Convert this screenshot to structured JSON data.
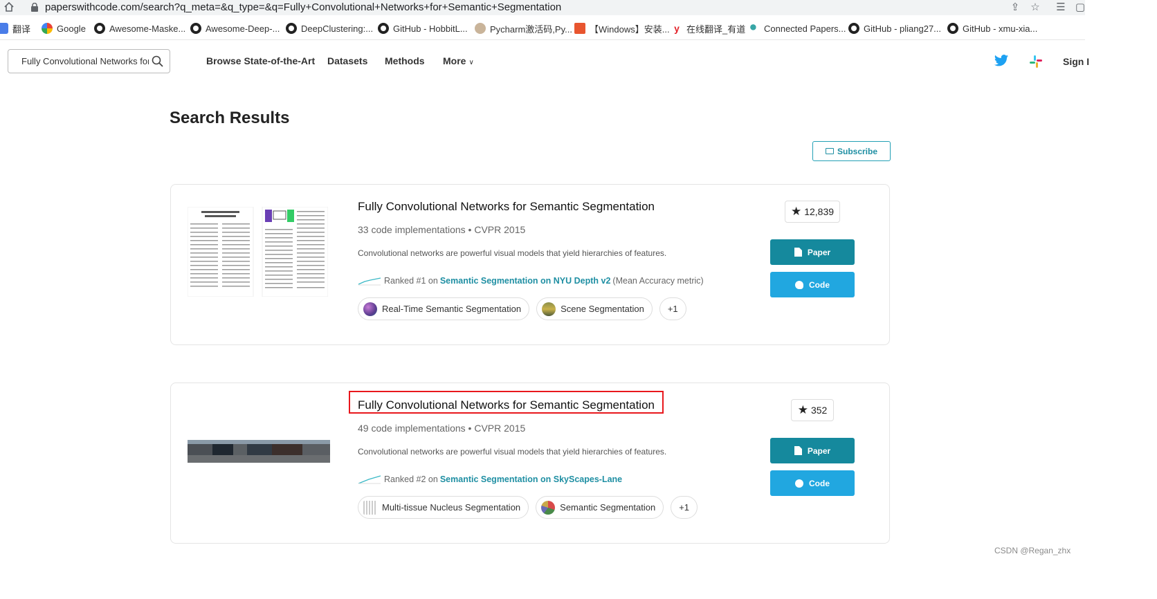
{
  "browser": {
    "url": "paperswithcode.com/search?q_meta=&q_type=&q=Fully+Convolutional+Networks+for+Semantic+Segmentation",
    "bookmarks": [
      {
        "label": "翻译",
        "icon": "translate-icon"
      },
      {
        "label": "Google",
        "icon": "google-icon"
      },
      {
        "label": "Awesome-Maske...",
        "icon": "github-icon"
      },
      {
        "label": "Awesome-Deep-...",
        "icon": "github-icon"
      },
      {
        "label": "DeepClustering:...",
        "icon": "github-icon"
      },
      {
        "label": "GitHub - HobbitL...",
        "icon": "github-icon"
      },
      {
        "label": "Pycharm激活码,Py...",
        "icon": "avatar-icon"
      },
      {
        "label": "【Windows】安装...",
        "icon": "csdn-icon"
      },
      {
        "label": "在线翻译_有道",
        "icon": "youdao-icon"
      },
      {
        "label": "Connected Papers...",
        "icon": "connected-papers-icon"
      },
      {
        "label": "GitHub - pliang27...",
        "icon": "github-icon"
      },
      {
        "label": "GitHub - xmu-xia...",
        "icon": "github-icon"
      }
    ]
  },
  "nav": {
    "search_value": "Fully Convolutional Networks for S",
    "links": [
      "Browse State-of-the-Art",
      "Datasets",
      "Methods",
      "More"
    ],
    "signin": "Sign I"
  },
  "page": {
    "title": "Search Results",
    "subscribe_label": "Subscribe"
  },
  "results": [
    {
      "title": "Fully Convolutional Networks for Semantic Segmentation",
      "implementations": "33 code implementations",
      "venue": "CVPR 2015",
      "abstract": "Convolutional networks are powerful visual models that yield hierarchies of features.",
      "rank_prefix": "Ranked #1 on",
      "rank_task": "Semantic Segmentation on NYU Depth v2",
      "rank_suffix": "(Mean Accuracy metric)",
      "tags": [
        "Real-Time Semantic Segmentation",
        "Scene Segmentation",
        "+1"
      ],
      "stars": "12,839",
      "paper_label": "Paper",
      "code_label": "Code"
    },
    {
      "title": "Fully Convolutional Networks for Semantic Segmentation",
      "implementations": "49 code implementations",
      "venue": "CVPR 2015",
      "abstract": "Convolutional networks are powerful visual models that yield hierarchies of features.",
      "rank_prefix": "Ranked #2 on",
      "rank_task": "Semantic Segmentation on SkyScapes-Lane",
      "rank_suffix": "",
      "tags": [
        "Multi-tissue Nucleus Segmentation",
        "Semantic Segmentation",
        "+1"
      ],
      "stars": "352",
      "paper_label": "Paper",
      "code_label": "Code"
    }
  ],
  "watermark": "CSDN @Regan_zhx",
  "colors": {
    "accent": "#15899d",
    "code_button": "#21a7e0",
    "highlight": "#e8171c"
  }
}
